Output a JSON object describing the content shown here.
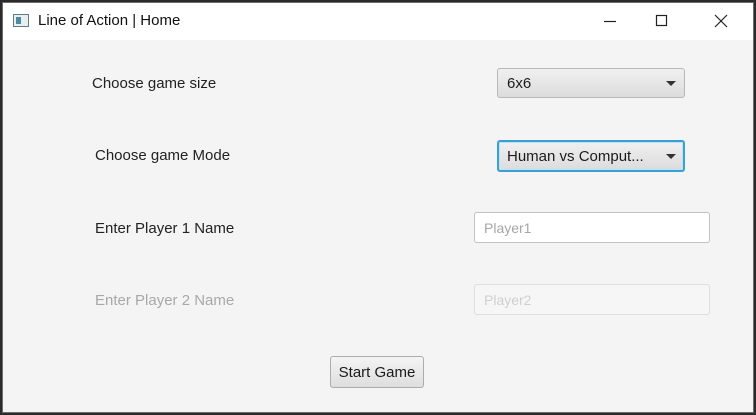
{
  "window": {
    "title": "Line of Action | Home",
    "controls": {
      "minimize": "minimize-icon",
      "maximize": "maximize-icon",
      "close": "close-icon"
    }
  },
  "form": {
    "game_size": {
      "label": "Choose game size",
      "selected": "6x6"
    },
    "game_mode": {
      "label": "Choose game Mode",
      "selected": "Human vs Comput..."
    },
    "player1": {
      "label": "Enter Player 1 Name",
      "placeholder": "Player1",
      "value": ""
    },
    "player2": {
      "label": "Enter Player 2 Name",
      "placeholder": "Player2",
      "value": "",
      "disabled": true
    },
    "start_label": "Start Game"
  },
  "colors": {
    "focus_ring": "#39a0d6",
    "window_bg": "#f4f4f4",
    "disabled_text": "#a8a8a8"
  }
}
